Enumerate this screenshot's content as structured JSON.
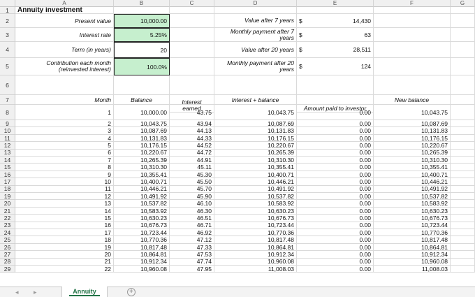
{
  "columns": [
    "A",
    "B",
    "C",
    "D",
    "E",
    "F",
    "G"
  ],
  "rows_header": [
    "1",
    "2",
    "3",
    "4",
    "5",
    "6",
    "7",
    "8",
    "9",
    "10",
    "11",
    "12",
    "13",
    "14",
    "15",
    "16",
    "17",
    "18",
    "19",
    "20",
    "21",
    "22",
    "23",
    "24",
    "25",
    "26",
    "27",
    "28",
    "29"
  ],
  "inputs": {
    "title": "Annuity investment",
    "present_value_label": "Present value",
    "present_value": "10,000.00",
    "interest_rate_label": "Interest rate",
    "interest_rate": "5.25%",
    "term_label": "Term (in years)",
    "term": "20",
    "contribution_label": "Contribution each month (reinvested interest)",
    "contribution": "100.0%"
  },
  "summary": {
    "value7_label": "Value after 7 years",
    "value7_cur": "$",
    "value7": "14,430",
    "pay7_label": "Monthly payment after 7 years",
    "pay7_cur": "$",
    "pay7": "63",
    "value20_label": "Value after 20 years",
    "value20_cur": "$",
    "value20": "28,511",
    "pay20_label": "Monthly payment after 20 years",
    "pay20_cur": "$",
    "pay20": "124"
  },
  "table_headers": {
    "month": "Month",
    "balance": "Balance",
    "interest": "Interest earned",
    "int_bal": "Interest + balance",
    "paid": "Amount paid to investor",
    "new_bal": "New balance"
  },
  "table_rows": [
    [
      "1",
      "10,000.00",
      "43.75",
      "10,043.75",
      "0.00",
      "10,043.75"
    ],
    [
      "2",
      "10,043.75",
      "43.94",
      "10,087.69",
      "0.00",
      "10,087.69"
    ],
    [
      "3",
      "10,087.69",
      "44.13",
      "10,131.83",
      "0.00",
      "10,131.83"
    ],
    [
      "4",
      "10,131.83",
      "44.33",
      "10,176.15",
      "0.00",
      "10,176.15"
    ],
    [
      "5",
      "10,176.15",
      "44.52",
      "10,220.67",
      "0.00",
      "10,220.67"
    ],
    [
      "6",
      "10,220.67",
      "44.72",
      "10,265.39",
      "0.00",
      "10,265.39"
    ],
    [
      "7",
      "10,265.39",
      "44.91",
      "10,310.30",
      "0.00",
      "10,310.30"
    ],
    [
      "8",
      "10,310.30",
      "45.11",
      "10,355.41",
      "0.00",
      "10,355.41"
    ],
    [
      "9",
      "10,355.41",
      "45.30",
      "10,400.71",
      "0.00",
      "10,400.71"
    ],
    [
      "10",
      "10,400.71",
      "45.50",
      "10,446.21",
      "0.00",
      "10,446.21"
    ],
    [
      "11",
      "10,446.21",
      "45.70",
      "10,491.92",
      "0.00",
      "10,491.92"
    ],
    [
      "12",
      "10,491.92",
      "45.90",
      "10,537.82",
      "0.00",
      "10,537.82"
    ],
    [
      "13",
      "10,537.82",
      "46.10",
      "10,583.92",
      "0.00",
      "10,583.92"
    ],
    [
      "14",
      "10,583.92",
      "46.30",
      "10,630.23",
      "0.00",
      "10,630.23"
    ],
    [
      "15",
      "10,630.23",
      "46.51",
      "10,676.73",
      "0.00",
      "10,676.73"
    ],
    [
      "16",
      "10,676.73",
      "46.71",
      "10,723.44",
      "0.00",
      "10,723.44"
    ],
    [
      "17",
      "10,723.44",
      "46.92",
      "10,770.36",
      "0.00",
      "10,770.36"
    ],
    [
      "18",
      "10,770.36",
      "47.12",
      "10,817.48",
      "0.00",
      "10,817.48"
    ],
    [
      "19",
      "10,817.48",
      "47.33",
      "10,864.81",
      "0.00",
      "10,864.81"
    ],
    [
      "20",
      "10,864.81",
      "47.53",
      "10,912.34",
      "0.00",
      "10,912.34"
    ],
    [
      "21",
      "10,912.34",
      "47.74",
      "10,960.08",
      "0.00",
      "10,960.08"
    ],
    [
      "22",
      "10,960.08",
      "47.95",
      "11,008.03",
      "0.00",
      "11,008.03"
    ]
  ],
  "sheet_tabs": {
    "prev": "◂",
    "next": "▸",
    "active": "Annuity",
    "add": "+"
  },
  "colors": {
    "input_fill": "#c6efce",
    "tab_accent": "#217346"
  }
}
